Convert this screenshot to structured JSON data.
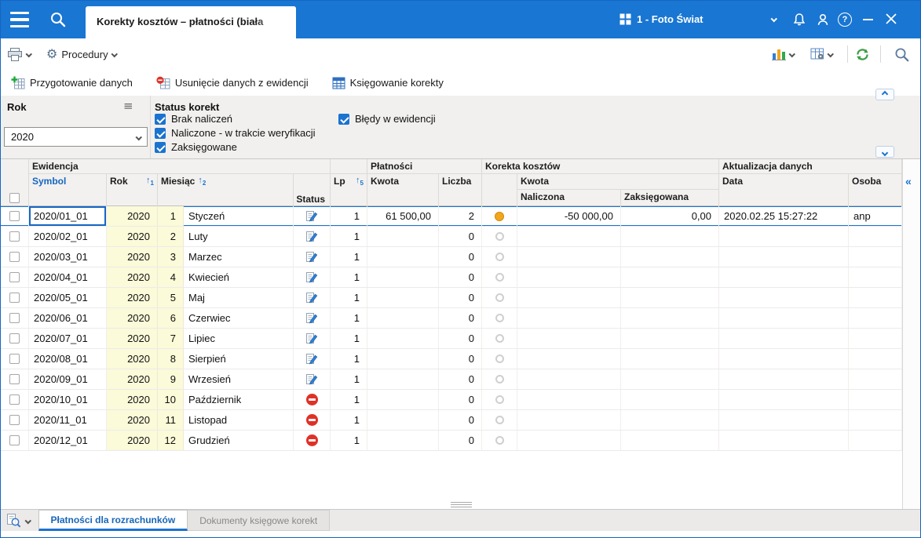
{
  "window": {
    "tab_title": "Korekty kosztów – płatności (biała",
    "company": "1 - Foto Świat"
  },
  "toolbar": {
    "procedury": "Procedury"
  },
  "actions": {
    "prepare": "Przygotowanie danych",
    "remove": "Usunięcie danych z ewidencji",
    "book": "Księgowanie korekty"
  },
  "filters": {
    "rok_label": "Rok",
    "rok_value": "2020",
    "status_label": "Status korekt",
    "checkboxes": [
      {
        "label": "Brak naliczeń",
        "checked": true
      },
      {
        "label": "Naliczone - w trakcie weryfikacji",
        "checked": true
      },
      {
        "label": "Zaksięgowane",
        "checked": true
      },
      {
        "label": "Błędy w ewidencji",
        "checked": true
      }
    ]
  },
  "table": {
    "groups": {
      "ewidencja": "Ewidencja",
      "platnosci": "Płatności",
      "korekta": "Korekta kosztów",
      "aktualizacja": "Aktualizacja danych"
    },
    "headers": {
      "symbol": "Symbol",
      "rok": "Rok",
      "miesiac": "Miesiąc",
      "status": "Status",
      "lp": "Lp",
      "kwota": "Kwota",
      "liczba": "Liczba",
      "kwota_korekty": "Kwota",
      "naliczona": "Naliczona",
      "zaksiegowana": "Zaksięgowana",
      "data": "Data",
      "osoba": "Osoba"
    },
    "sort": {
      "rok": "1",
      "miesiac": "2",
      "lp": "5"
    },
    "rows": [
      {
        "symbol": "2020/01_01",
        "rok": "2020",
        "nr": "1",
        "miesiac": "Styczeń",
        "status": "edit",
        "lp": "1",
        "kwota": "61 500,00",
        "liczba": "2",
        "korekta": "filled",
        "naliczona": "-50 000,00",
        "zaksiegowana": "0,00",
        "data": "2020.02.25 15:27:22",
        "osoba": "anp",
        "selected": true
      },
      {
        "symbol": "2020/02_01",
        "rok": "2020",
        "nr": "2",
        "miesiac": "Luty",
        "status": "edit",
        "lp": "1",
        "kwota": "",
        "liczba": "0",
        "korekta": "empty",
        "naliczona": "",
        "zaksiegowana": "",
        "data": "",
        "osoba": "",
        "selected": false
      },
      {
        "symbol": "2020/03_01",
        "rok": "2020",
        "nr": "3",
        "miesiac": "Marzec",
        "status": "edit",
        "lp": "1",
        "kwota": "",
        "liczba": "0",
        "korekta": "empty",
        "naliczona": "",
        "zaksiegowana": "",
        "data": "",
        "osoba": "",
        "selected": false
      },
      {
        "symbol": "2020/04_01",
        "rok": "2020",
        "nr": "4",
        "miesiac": "Kwiecień",
        "status": "edit",
        "lp": "1",
        "kwota": "",
        "liczba": "0",
        "korekta": "empty",
        "naliczona": "",
        "zaksiegowana": "",
        "data": "",
        "osoba": "",
        "selected": false
      },
      {
        "symbol": "2020/05_01",
        "rok": "2020",
        "nr": "5",
        "miesiac": "Maj",
        "status": "edit",
        "lp": "1",
        "kwota": "",
        "liczba": "0",
        "korekta": "empty",
        "naliczona": "",
        "zaksiegowana": "",
        "data": "",
        "osoba": "",
        "selected": false
      },
      {
        "symbol": "2020/06_01",
        "rok": "2020",
        "nr": "6",
        "miesiac": "Czerwiec",
        "status": "edit",
        "lp": "1",
        "kwota": "",
        "liczba": "0",
        "korekta": "empty",
        "naliczona": "",
        "zaksiegowana": "",
        "data": "",
        "osoba": "",
        "selected": false
      },
      {
        "symbol": "2020/07_01",
        "rok": "2020",
        "nr": "7",
        "miesiac": "Lipiec",
        "status": "edit",
        "lp": "1",
        "kwota": "",
        "liczba": "0",
        "korekta": "empty",
        "naliczona": "",
        "zaksiegowana": "",
        "data": "",
        "osoba": "",
        "selected": false
      },
      {
        "symbol": "2020/08_01",
        "rok": "2020",
        "nr": "8",
        "miesiac": "Sierpień",
        "status": "edit",
        "lp": "1",
        "kwota": "",
        "liczba": "0",
        "korekta": "empty",
        "naliczona": "",
        "zaksiegowana": "",
        "data": "",
        "osoba": "",
        "selected": false
      },
      {
        "symbol": "2020/09_01",
        "rok": "2020",
        "nr": "9",
        "miesiac": "Wrzesień",
        "status": "edit",
        "lp": "1",
        "kwota": "",
        "liczba": "0",
        "korekta": "empty",
        "naliczona": "",
        "zaksiegowana": "",
        "data": "",
        "osoba": "",
        "selected": false
      },
      {
        "symbol": "2020/10_01",
        "rok": "2020",
        "nr": "10",
        "miesiac": "Październik",
        "status": "blocked",
        "lp": "1",
        "kwota": "",
        "liczba": "0",
        "korekta": "empty",
        "naliczona": "",
        "zaksiegowana": "",
        "data": "",
        "osoba": "",
        "selected": false
      },
      {
        "symbol": "2020/11_01",
        "rok": "2020",
        "nr": "11",
        "miesiac": "Listopad",
        "status": "blocked",
        "lp": "1",
        "kwota": "",
        "liczba": "0",
        "korekta": "empty",
        "naliczona": "",
        "zaksiegowana": "",
        "data": "",
        "osoba": "",
        "selected": false
      },
      {
        "symbol": "2020/12_01",
        "rok": "2020",
        "nr": "12",
        "miesiac": "Grudzień",
        "status": "blocked",
        "lp": "1",
        "kwota": "",
        "liczba": "0",
        "korekta": "empty",
        "naliczona": "",
        "zaksiegowana": "",
        "data": "",
        "osoba": "",
        "selected": false
      }
    ]
  },
  "bottom_tabs": [
    {
      "label": "Płatności dla rozrachunków",
      "active": true
    },
    {
      "label": "Dokumenty księgowe korekt",
      "active": false
    }
  ],
  "colors": {
    "accent": "#1a73cf",
    "topbar": "#1976d2",
    "status_orange": "#f2a71b",
    "blocked_red": "#e03127",
    "refresh_green": "#3d9e46"
  }
}
